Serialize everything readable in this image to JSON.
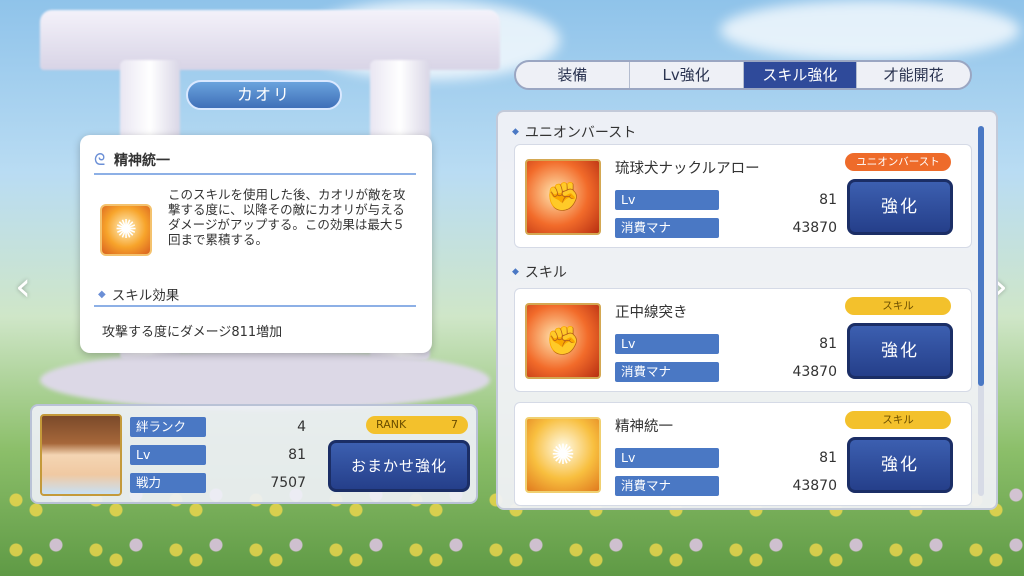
{
  "character": {
    "name": "カオリ"
  },
  "tabs": [
    {
      "label": "装備",
      "active": false
    },
    {
      "label": "Lv強化",
      "active": false
    },
    {
      "label": "スキル強化",
      "active": true
    },
    {
      "label": "才能開花",
      "active": false
    }
  ],
  "tooltip": {
    "title": "精神統一",
    "description": "このスキルを使用した後、カオリが敵を攻撃する度に、以降その敵にカオリが与えるダメージがアップする。この効果は最大５回まで累積する。",
    "effect_heading": "スキル効果",
    "effect": "攻撃する度にダメージ811増加"
  },
  "status": {
    "rank_label": "絆ランク",
    "rank_value": "4",
    "lv_label": "Lv",
    "lv_value": "81",
    "power_label": "戦力",
    "power_value": "7507",
    "rank_badge_left": "RANK",
    "rank_badge_right": "7",
    "auto_button": "おまかせ強化"
  },
  "sections": {
    "union": "ユニオンバースト",
    "skill": "スキル"
  },
  "skills": [
    {
      "name": "琉球犬ナックルアロー",
      "badge": "ユニオンバースト",
      "badge_type": "union",
      "lv_label": "Lv",
      "lv": "81",
      "mana_label": "消費マナ",
      "mana": "43870",
      "button": "強化",
      "icon": "fist-icon"
    },
    {
      "name": "正中線突き",
      "badge": "スキル",
      "badge_type": "skill",
      "lv_label": "Lv",
      "lv": "81",
      "mana_label": "消費マナ",
      "mana": "43870",
      "button": "強化",
      "icon": "fist-icon"
    },
    {
      "name": "精神統一",
      "badge": "スキル",
      "badge_type": "skill",
      "lv_label": "Lv",
      "lv": "81",
      "mana_label": "消費マナ",
      "mana": "43870",
      "button": "強化",
      "icon": "meditation-icon"
    }
  ],
  "nav": {
    "left": "‹",
    "right": "›"
  },
  "colors": {
    "accent": "#4a78c4",
    "button": "#2f4a9a",
    "union_badge": "#ee6b2a",
    "skill_badge": "#f3c12c"
  }
}
